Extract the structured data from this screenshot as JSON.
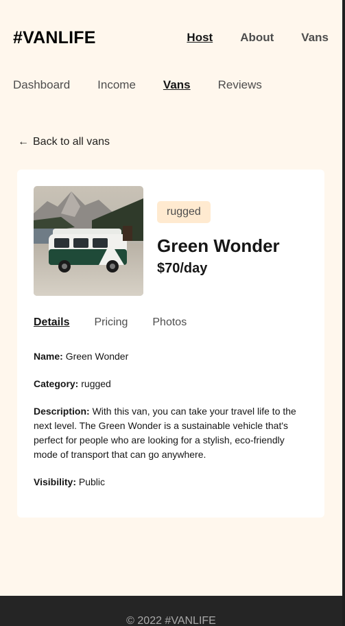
{
  "header": {
    "logo": "#VANLIFE",
    "nav": [
      {
        "label": "Host",
        "active": true
      },
      {
        "label": "About",
        "active": false
      },
      {
        "label": "Vans",
        "active": false
      }
    ]
  },
  "host_nav": [
    {
      "label": "Dashboard",
      "active": false
    },
    {
      "label": "Income",
      "active": false
    },
    {
      "label": "Vans",
      "active": true
    },
    {
      "label": "Reviews",
      "active": false
    }
  ],
  "back_link": "Back to all vans",
  "van": {
    "type": "rugged",
    "name": "Green Wonder",
    "price": "$70/day",
    "image_alt": "green and white camper van"
  },
  "tabs": [
    {
      "label": "Details",
      "active": true
    },
    {
      "label": "Pricing",
      "active": false
    },
    {
      "label": "Photos",
      "active": false
    }
  ],
  "details": {
    "name_label": "Name:",
    "name_value": "Green Wonder",
    "category_label": "Category:",
    "category_value": "rugged",
    "description_label": "Description:",
    "description_value": "With this van, you can take your travel life to the next level. The Green Wonder is a sustainable vehicle that's perfect for people who are looking for a stylish, eco-friendly mode of transport that can go anywhere.",
    "visibility_label": "Visibility:",
    "visibility_value": "Public"
  },
  "footer": "© 2022 #VANLIFE",
  "colors": {
    "background": "#fff7ed",
    "badge_bg": "#ffead0",
    "footer_bg": "#252525"
  }
}
